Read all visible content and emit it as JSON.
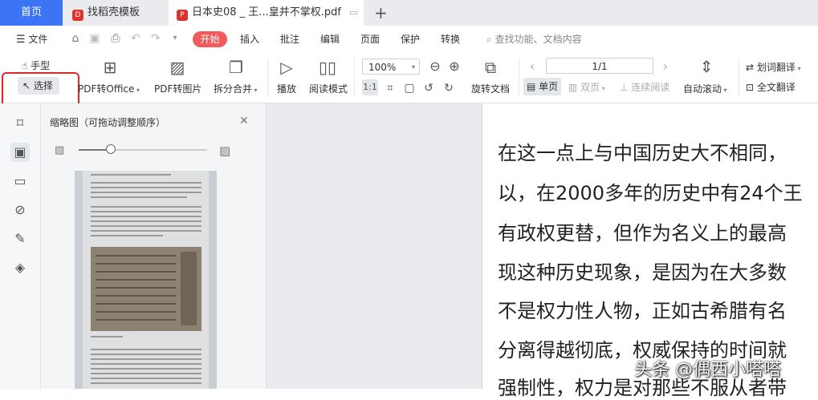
{
  "tabs": {
    "home": "首页",
    "tab1": "找稻壳模板",
    "tab2": "日本史08 _ 王...皇并不掌权.pdf",
    "add": "+"
  },
  "menu": {
    "file": "文件",
    "start": "开始",
    "items": [
      "插入",
      "批注",
      "编辑",
      "页面",
      "保护",
      "转换"
    ],
    "search": "查找功能、文档内容"
  },
  "ribbon": {
    "hand": "手型",
    "select": "选择",
    "pdf_to_office": "PDF转Office",
    "pdf_to_image": "PDF转图片",
    "split_merge": "拆分合并",
    "play": "播放",
    "read_mode": "阅读模式",
    "zoom": "100%",
    "page_indicator": "1/1",
    "rotate": "旋转文档",
    "single_page": "单页",
    "double_page": "双页",
    "continuous": "连续阅读",
    "auto_scroll": "自动滚动",
    "word_translate": "划词翻译",
    "full_translate": "全文翻译"
  },
  "thumbnails": {
    "title": "缩略图（可拖动调整顺序）",
    "slider_value": 0.25
  },
  "document": {
    "lines": [
      "在这一点上与中国历史大不相同，",
      "以，在2000多年的历史中有24个王",
      "有政权更替，但作为名义上的最高",
      "现这种历史现象，是因为在大多数",
      "不是权力性人物，正如古希腊有名",
      "分离得越彻底，权威保持的时间就",
      "强制性，权力是对那些不服从者带"
    ]
  },
  "watermark": "头条 @偶西小嗒嗒",
  "colors": {
    "accent": "#3b74f5",
    "start": "#f05a5a",
    "annotation": "#e0262b"
  }
}
